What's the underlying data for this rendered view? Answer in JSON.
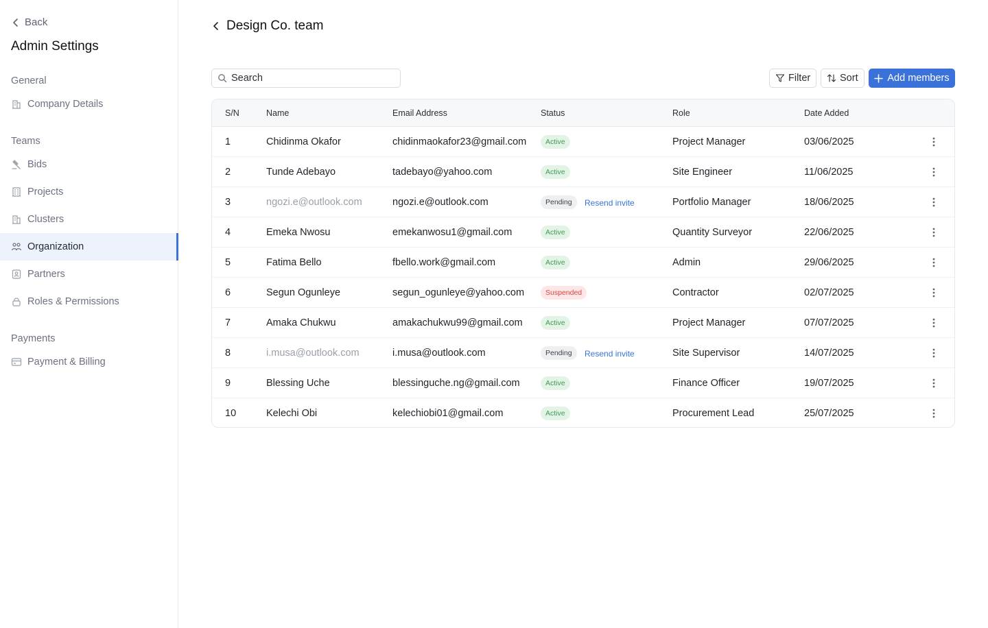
{
  "sidebar": {
    "back_label": "Back",
    "title": "Admin Settings",
    "sections": [
      {
        "label": "General",
        "items": [
          {
            "label": "Company Details",
            "icon": "building-icon"
          }
        ]
      },
      {
        "label": "Teams",
        "items": [
          {
            "label": "Bids",
            "icon": "gavel-icon"
          },
          {
            "label": "Projects",
            "icon": "building-icon"
          },
          {
            "label": "Clusters",
            "icon": "building-icon"
          },
          {
            "label": "Organization",
            "icon": "users-icon",
            "active": true
          },
          {
            "label": "Partners",
            "icon": "id-badge-icon"
          },
          {
            "label": "Roles & Permissions",
            "icon": "lock-icon"
          }
        ]
      },
      {
        "label": "Payments",
        "items": [
          {
            "label": "Payment & Billing",
            "icon": "card-icon"
          }
        ]
      }
    ]
  },
  "header": {
    "title": "Design Co. team"
  },
  "toolbar": {
    "search_placeholder": "Search",
    "filter_label": "Filter",
    "sort_label": "Sort",
    "add_label": "Add members"
  },
  "table": {
    "columns": [
      "S/N",
      "Name",
      "Email Address",
      "Status",
      "Role",
      "Date Added"
    ],
    "resend_label": "Resend invite",
    "rows": [
      {
        "sn": "1",
        "name": "Chidinma Okafor",
        "email": "chidinmaokafor23@gmail.com",
        "status": "Active",
        "role": "Project Manager",
        "date": "03/06/2025"
      },
      {
        "sn": "2",
        "name": "Tunde Adebayo",
        "email": "tadebayo@yahoo.com",
        "status": "Active",
        "role": "Site Engineer",
        "date": "11/06/2025"
      },
      {
        "sn": "3",
        "name": "ngozi.e@outlook.com",
        "email": "ngozi.e@outlook.com",
        "status": "Pending",
        "role": "Portfolio Manager",
        "date": "18/06/2025"
      },
      {
        "sn": "4",
        "name": "Emeka Nwosu",
        "email": "emekanwosu1@gmail.com",
        "status": "Active",
        "role": "Quantity Surveyor",
        "date": "22/06/2025"
      },
      {
        "sn": "5",
        "name": "Fatima Bello",
        "email": "fbello.work@gmail.com",
        "status": "Active",
        "role": "Admin",
        "date": "29/06/2025"
      },
      {
        "sn": "6",
        "name": "Segun Ogunleye",
        "email": "segun_ogunleye@yahoo.com",
        "status": "Suspended",
        "role": "Contractor",
        "date": "02/07/2025"
      },
      {
        "sn": "7",
        "name": "Amaka Chukwu",
        "email": "amakachukwu99@gmail.com",
        "status": "Active",
        "role": "Project Manager",
        "date": "07/07/2025"
      },
      {
        "sn": "8",
        "name": "i.musa@outlook.com",
        "email": "i.musa@outlook.com",
        "status": "Pending",
        "role": "Site Supervisor",
        "date": "14/07/2025"
      },
      {
        "sn": "9",
        "name": "Blessing Uche",
        "email": "blessinguche.ng@gmail.com",
        "status": "Active",
        "role": "Finance Officer",
        "date": "19/07/2025"
      },
      {
        "sn": "10",
        "name": "Kelechi Obi",
        "email": "kelechiobi01@gmail.com",
        "status": "Active",
        "role": "Procurement Lead",
        "date": "25/07/2025"
      }
    ]
  },
  "colors": {
    "accent": "#3b72d9",
    "active_bg": "#e3f4e6",
    "active_text": "#3e9c52",
    "suspended_bg": "#fde6e6",
    "suspended_text": "#d84848"
  }
}
